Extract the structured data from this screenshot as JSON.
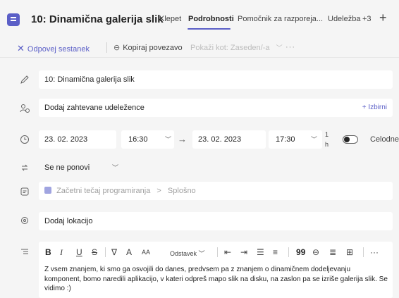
{
  "header": {
    "title": "10: Dinamična galerija slik",
    "tabs": [
      {
        "label": "Klepet"
      },
      {
        "label": "Podrobnosti"
      },
      {
        "label": "Pomočnik za razporeja..."
      },
      {
        "label": "Udeležba"
      },
      {
        "label": "+3"
      }
    ],
    "add_tab_glyph": "+"
  },
  "toolbar": {
    "cancel_label": "Odpovej sestanek",
    "copy_link_label": "Kopiraj povezavo",
    "show_as_label": "Pokaži kot: Zaseden/-a",
    "more_glyph": "···"
  },
  "form": {
    "title_value": "10: Dinamična galerija slik",
    "attendees_placeholder": "Dodaj zahtevane udeležence",
    "attendees_optional": "+ Izbirni",
    "start_date": "23. 02. 2023",
    "start_time": "16:30",
    "end_date": "23. 02. 2023",
    "end_time": "17:30",
    "duration_value": "1",
    "duration_unit": "h",
    "all_day_label": "Celodnevno",
    "recurrence": "Se ne ponovi",
    "channel_team": "Začetni tečaj programiranja",
    "channel_sep": ">",
    "channel_name": "Splošno",
    "location_placeholder": "Dodaj lokacijo"
  },
  "editor": {
    "paragraph_style": "Odstavek",
    "body": "Z vsem znanjem, ki smo ga osvojili do danes, predvsem pa z znanjem o dinamičnem dodeljevanju komponent, bomo naredili aplikacijo, v kateri odpreš mapo slik na disku, na zaslon pa se izriše galerija slik. Se vidimo :)"
  },
  "colors": {
    "accent": "#5b5fc7"
  }
}
